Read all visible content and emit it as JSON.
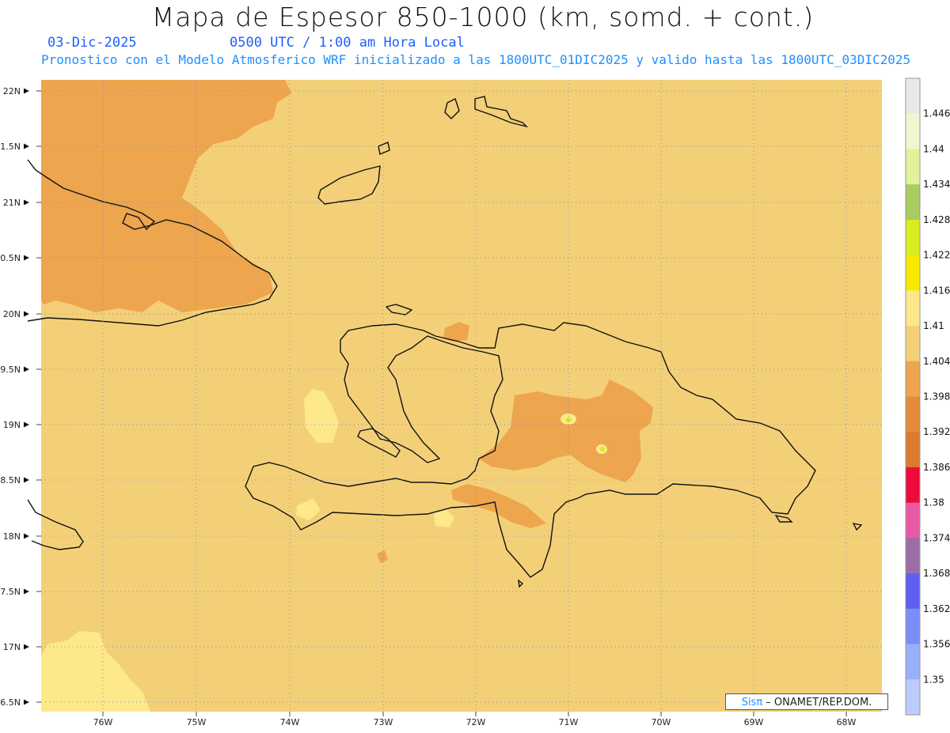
{
  "header": {
    "title": "Mapa de Espesor 850-1000 (km, somd. + cont.)",
    "date": "03-Dic-2025",
    "time": "0500 UTC / 1:00 am Hora Local",
    "subtitle": "Pronostico con el Modelo Atmosferico WRF inicializado a las 1800UTC_01DIC2025 y valido hasta las  1800UTC_03DIC2025"
  },
  "axes": {
    "lat_labels": [
      "22N",
      "1.5N",
      "21N",
      "0.5N",
      "20N",
      "9.5N",
      "19N",
      "8.5N",
      "18N",
      "7.5N",
      "17N",
      "6.5N"
    ],
    "lon_labels": [
      "76W",
      "75W",
      "74W",
      "73W",
      "72W",
      "71W",
      "70W",
      "69W",
      "68W"
    ]
  },
  "colorbar": {
    "labels": [
      "1.446",
      "1.44",
      "1.434",
      "1.428",
      "1.422",
      "1.416",
      "1.41",
      "1.404",
      "1.398",
      "1.392",
      "1.386",
      "1.38",
      "1.374",
      "1.368",
      "1.362",
      "1.356",
      "1.35"
    ],
    "colors": [
      "#e8e8e8",
      "#f2f5d0",
      "#e0f29a",
      "#a8cc60",
      "#d8ec20",
      "#f8e800",
      "#fde98a",
      "#f3d078",
      "#eda54e",
      "#e58a38",
      "#dd7a2c",
      "#ec0b3a",
      "#e85aa6",
      "#9b6ea8",
      "#6060f0",
      "#7a8ef8",
      "#98b0fa",
      "#bccbfb"
    ]
  },
  "credit": {
    "brand": "Sisπ",
    "text": " – ONAMET/REP.DOM."
  }
}
